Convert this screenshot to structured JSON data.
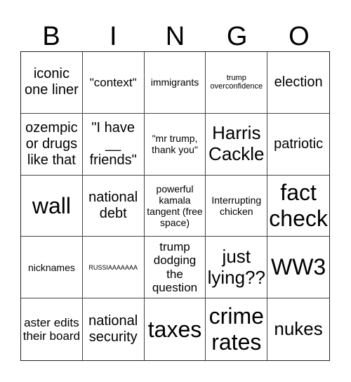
{
  "header": {
    "letters": [
      "B",
      "I",
      "N",
      "G",
      "O"
    ]
  },
  "cells": [
    {
      "text": "iconic one liner",
      "size": "l"
    },
    {
      "text": "\"context\"",
      "size": "m"
    },
    {
      "text": "immigrants",
      "size": "s"
    },
    {
      "text": "trump overconfidence",
      "size": "xs"
    },
    {
      "text": "election",
      "size": "l"
    },
    {
      "text": "ozempic or drugs like that",
      "size": "l"
    },
    {
      "text": "\"I have __ friends\"",
      "size": "l"
    },
    {
      "text": "\"mr trump, thank you\"",
      "size": "s"
    },
    {
      "text": "Harris Cackle",
      "size": "xl"
    },
    {
      "text": "patriotic",
      "size": "l"
    },
    {
      "text": "wall",
      "size": "xxl"
    },
    {
      "text": "national debt",
      "size": "l"
    },
    {
      "text": "powerful kamala tangent (free space)",
      "size": "s"
    },
    {
      "text": "Interrupting chicken",
      "size": "s"
    },
    {
      "text": "fact check",
      "size": "xxl"
    },
    {
      "text": "nicknames",
      "size": "s"
    },
    {
      "text": "RUSSIAAAAAAA",
      "size": "xxs"
    },
    {
      "text": "trump dodging the question",
      "size": "m"
    },
    {
      "text": "just lying??",
      "size": "xl"
    },
    {
      "text": "WW3",
      "size": "xxl"
    },
    {
      "text": "aster edits their board",
      "size": "m"
    },
    {
      "text": "national security",
      "size": "l"
    },
    {
      "text": "taxes",
      "size": "xxl"
    },
    {
      "text": "crime rates",
      "size": "xxl"
    },
    {
      "text": "nukes",
      "size": "xl"
    }
  ]
}
